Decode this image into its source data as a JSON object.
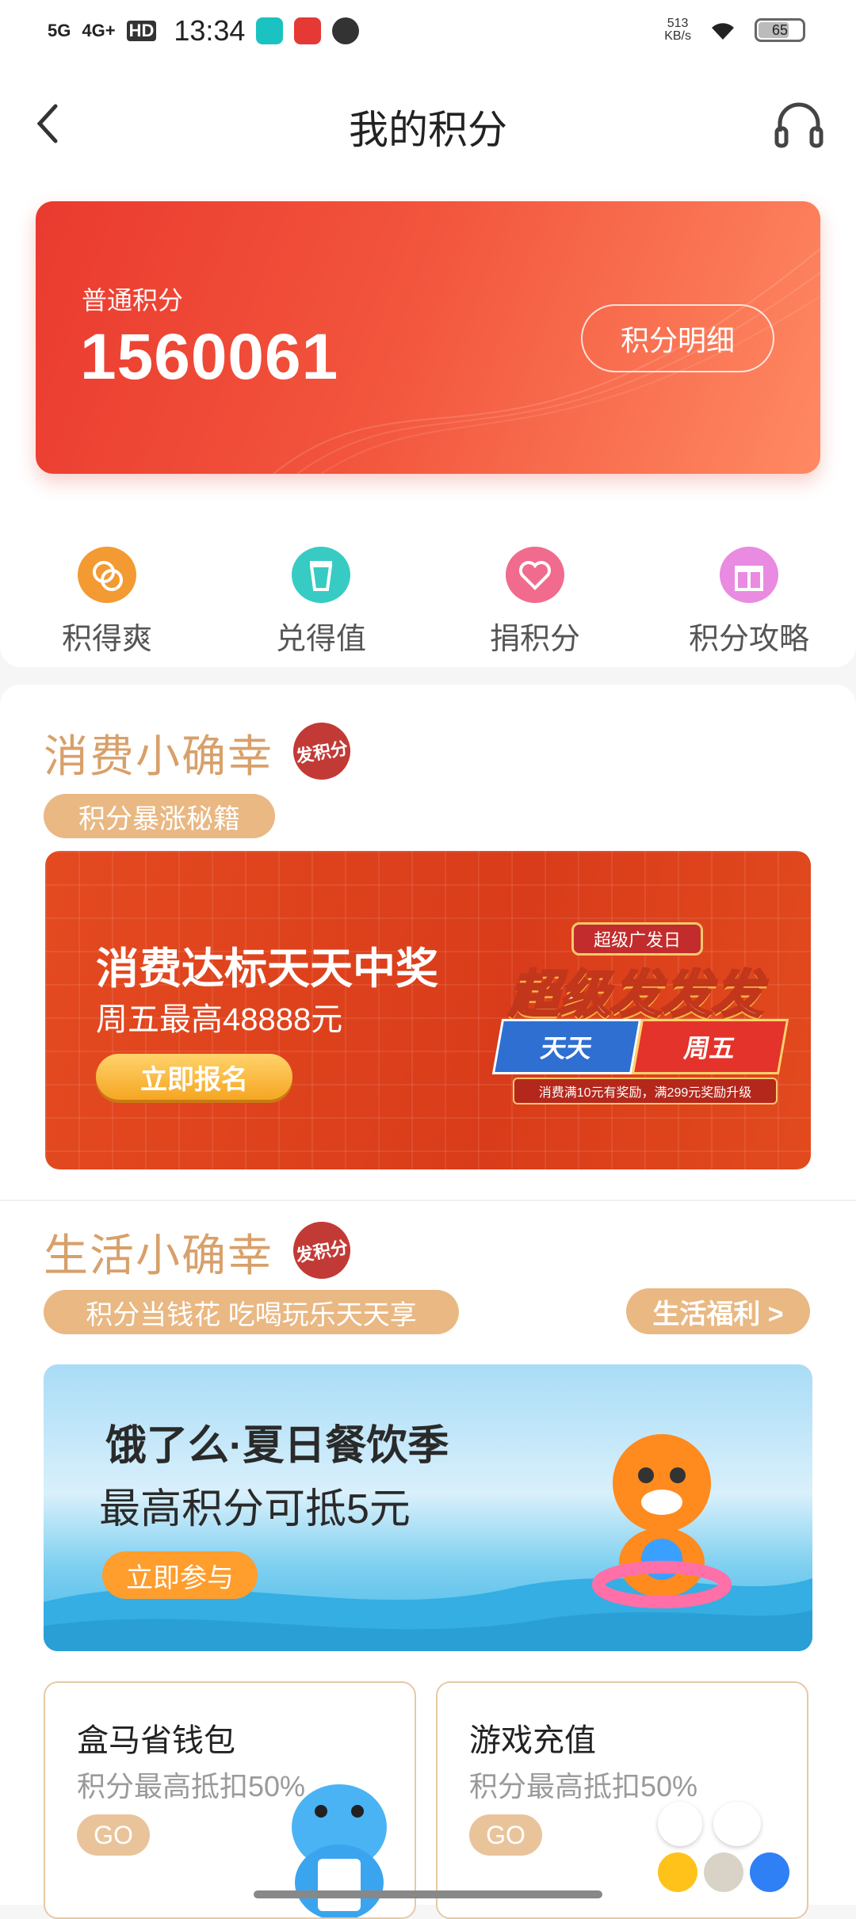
{
  "status_bar": {
    "signal1": "5G",
    "signal2": "4G+",
    "hd": "HD",
    "time": "13:34",
    "net_speed_value": "513",
    "net_speed_unit": "KB/s",
    "battery_level": "65",
    "battery_fraction": 0.65
  },
  "header": {
    "title": "我的积分"
  },
  "points_card": {
    "label": "普通积分",
    "value": "1560061",
    "detail_button": "积分明细"
  },
  "quick_actions": [
    {
      "label": "积得爽",
      "icon": "coin-icon",
      "color": "#f39a32"
    },
    {
      "label": "兑得值",
      "icon": "cup-icon",
      "color": "#37cbc3"
    },
    {
      "label": "捐积分",
      "icon": "heart-icon",
      "color": "#f06b8d"
    },
    {
      "label": "积分攻略",
      "icon": "gift-icon",
      "color": "#e98be0"
    }
  ],
  "section1": {
    "title": "消费小确幸",
    "seal_text": "发积分",
    "tag": "积分暴涨秘籍",
    "banner": {
      "headline": "消费达标天天中奖",
      "subline": "周五最高48888元",
      "button": "立即报名",
      "badge_top": "超级广发日",
      "badge_main": "超级发发发",
      "badge_left": "天天",
      "badge_right": "周五",
      "badge_bar": "消费满10元有奖励，满299元奖励升级"
    }
  },
  "section2": {
    "title": "生活小确幸",
    "seal_text": "发积分",
    "tag": "积分当钱花  吃喝玩乐天天享",
    "link": "生活福利 >",
    "banner": {
      "headline": "饿了么·夏日餐饮季",
      "subline": "最高积分可抵5元",
      "button": "立即参与"
    }
  },
  "cards": [
    {
      "title": "盒马省钱包",
      "subtitle": "积分最高抵扣50%",
      "button": "GO"
    },
    {
      "title": "游戏充值",
      "subtitle": "积分最高抵扣50%",
      "button": "GO"
    }
  ],
  "colors": {
    "accent_red": "#ea3a2f",
    "gold": "#d8a06a",
    "pill": "#e9b883"
  }
}
